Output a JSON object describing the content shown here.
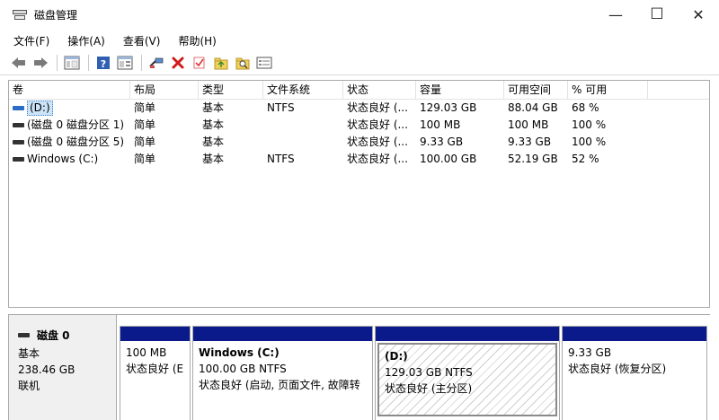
{
  "window": {
    "title": "磁盘管理",
    "minimize": "—",
    "maximize": "☐",
    "close": "✕"
  },
  "menu": [
    "文件(F)",
    "操作(A)",
    "查看(V)",
    "帮助(H)"
  ],
  "toolbar": [
    "back-icon",
    "forward-icon",
    "console-tree-icon",
    "help-icon",
    "properties-icon",
    "connect-icon",
    "delete-icon",
    "check-icon",
    "folder-up-icon",
    "search-folder-icon",
    "list-view-icon"
  ],
  "columns": [
    "卷",
    "布局",
    "类型",
    "文件系统",
    "状态",
    "容量",
    "可用空间",
    "% 可用"
  ],
  "volumes": [
    {
      "name": "(D:)",
      "layout": "简单",
      "type": "基本",
      "fs": "NTFS",
      "status": "状态良好 (...",
      "capacity": "129.03 GB",
      "free": "88.04 GB",
      "pct": "68 %",
      "selected": true
    },
    {
      "name": "(磁盘 0 磁盘分区 1)",
      "layout": "简单",
      "type": "基本",
      "fs": "",
      "status": "状态良好 (...",
      "capacity": "100 MB",
      "free": "100 MB",
      "pct": "100 %"
    },
    {
      "name": "(磁盘 0 磁盘分区 5)",
      "layout": "简单",
      "type": "基本",
      "fs": "",
      "status": "状态良好 (...",
      "capacity": "9.33 GB",
      "free": "9.33 GB",
      "pct": "100 %"
    },
    {
      "name": "Windows (C:)",
      "layout": "简单",
      "type": "基本",
      "fs": "NTFS",
      "status": "状态良好 (...",
      "capacity": "100.00 GB",
      "free": "52.19 GB",
      "pct": "52 %"
    }
  ],
  "disk": {
    "name": "磁盘 0",
    "type": "基本",
    "size": "238.46 GB",
    "state": "联机"
  },
  "partitions": [
    {
      "name": "",
      "size": "100 MB",
      "status": "状态良好 (E"
    },
    {
      "name": "Windows  (C:)",
      "size": "100.00 GB NTFS",
      "status": "状态良好 (启动, 页面文件, 故障转"
    },
    {
      "name": "(D:)",
      "size": "129.03 GB NTFS",
      "status": "状态良好 (主分区)"
    },
    {
      "name": "",
      "size": "9.33 GB",
      "status": "状态良好 (恢复分区)"
    }
  ],
  "colors": {
    "partition_bar": "#0b1a8a",
    "selection": "#cce4f7"
  }
}
